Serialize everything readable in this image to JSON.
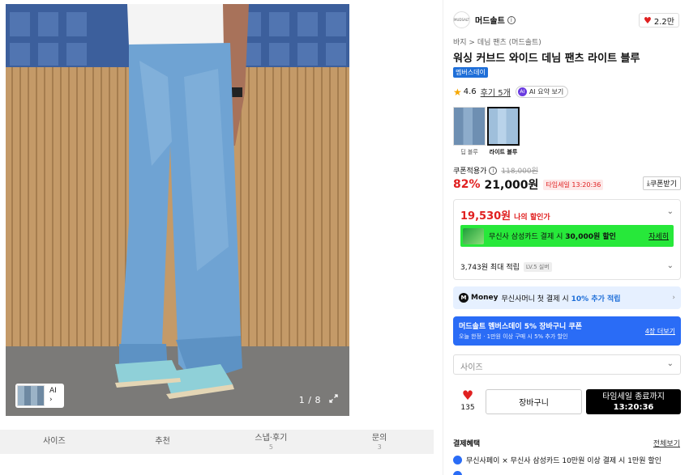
{
  "gallery": {
    "thumb_ai_label": "AI",
    "thumb_arrow": "›",
    "counter": "1 / 8",
    "expand_icon": "expand-icon"
  },
  "tabs": [
    {
      "label": "사이즈",
      "count": ""
    },
    {
      "label": "추천",
      "count": ""
    },
    {
      "label": "스냅·후기",
      "count": "5"
    },
    {
      "label": "문의",
      "count": "3"
    }
  ],
  "brand": {
    "logo_text": "MUDSALT",
    "name": "머드솔트",
    "like_count": "2.2만"
  },
  "product": {
    "breadcrumb": "바지 > 데님 팬츠 (머드솔트)",
    "title": "워싱 커브드 와이드 데님 팬츠 라이트 블루",
    "member_badge": "멤버스데이",
    "rating": "4.6",
    "reviews": "후기 5개",
    "ai_chip": "AI 요약 보기"
  },
  "colors": [
    {
      "label": "딥 블루",
      "selected": false
    },
    {
      "label": "라이트 블루",
      "selected": true
    }
  ],
  "price": {
    "coupon_label": "쿠폰적용가",
    "original": "118,000원",
    "discount": "82%",
    "final": "21,000원",
    "timesale": "타임세일 13:20:36",
    "coupon_button": "쿠폰받기"
  },
  "benefit": {
    "my_price": "19,530원",
    "my_price_label": "나의 할인가",
    "promo_text_a": "무신사 삼성카드 결제 시 ",
    "promo_text_b": "30,000원 할인",
    "promo_more": "자세히",
    "points": "3,743원 최대 적립",
    "level_badge": "LV.5 실버"
  },
  "money": {
    "brand": "Money",
    "text": "무신사머니 첫 결제 시",
    "pct": "10% 추가 적립"
  },
  "member_coupon": {
    "title": "머드솔트 멤버스데이 5% 장바구니 쿠폰",
    "sub": "오늘 한정 · 1만원 이상 구매 시 5% 추가 할인",
    "more": "4장 더보기"
  },
  "size_select": {
    "placeholder": "사이즈"
  },
  "actions": {
    "like_count": "135",
    "cart": "장바구니",
    "buy_line1": "타임세일 종료까지",
    "buy_line2": "13:20:36"
  },
  "payment": {
    "title": "결제혜택",
    "all": "전체보기",
    "line1": "무신사페이 × 무신사 삼성카드 10만원 이상 결제 시 1만원 할인"
  }
}
